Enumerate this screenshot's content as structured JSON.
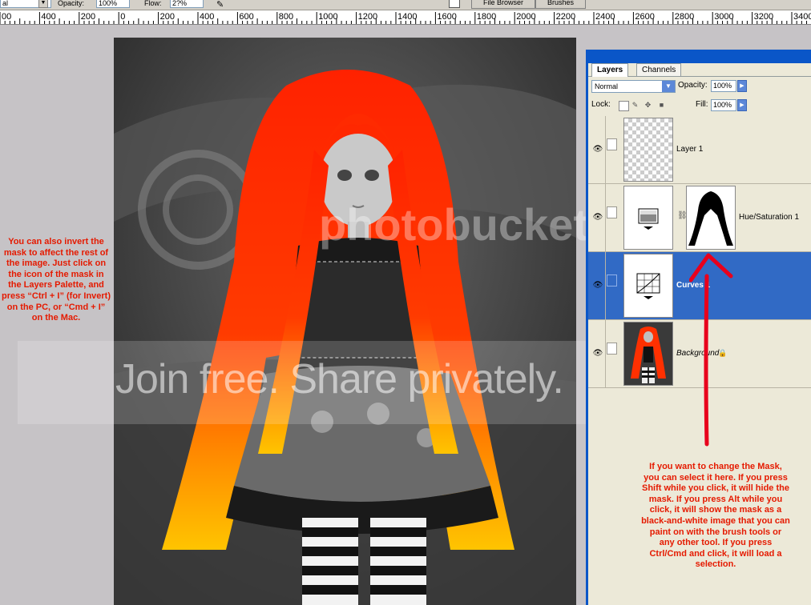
{
  "options_bar": {
    "mode_value": "al",
    "opacity_label": "Opacity:",
    "opacity_value": "100%",
    "flow_label": "Flow:",
    "flow_value": "2?%",
    "file_browser_tab": "File Browser",
    "brushes_tab": "Brushes"
  },
  "ruler": {
    "labels": [
      "00",
      "400",
      "200",
      "0",
      "200",
      "400",
      "600",
      "800",
      "1000",
      "1200",
      "1400",
      "1600",
      "1800",
      "2000",
      "2200",
      "2400",
      "2600",
      "2800",
      "3000",
      "3200",
      "3400"
    ]
  },
  "layers_panel": {
    "tabs": [
      {
        "label": "Layers",
        "active": true
      },
      {
        "label": "Channels",
        "active": false
      }
    ],
    "blend_mode": "Normal",
    "opacity_label": "Opacity:",
    "opacity_value": "100%",
    "lock_label": "Lock:",
    "fill_label": "Fill:",
    "fill_value": "100%",
    "layers": [
      {
        "name": "Layer 1",
        "visible": true,
        "active": false
      },
      {
        "name": "Hue/Saturation 1",
        "visible": true,
        "active": false
      },
      {
        "name": "Curves 1",
        "visible": true,
        "active": true
      },
      {
        "name": "Background",
        "visible": true,
        "active": false
      }
    ]
  },
  "annotations": {
    "left": "You can also invert the mask to affect the rest of the image. Just click on the icon of the mask in the Layers Palette, and press “Ctrl + I” (for Invert) on the PC, or “Cmd + I” on the Mac.",
    "right": "If you want to change the Mask, you can select it here. If you press Shift while you click, it will hide the mask. If you press Alt while you click, it will show the mask as a black-and-white image that you can paint on with the brush tools or any other tool. If you press Ctrl/Cmd and click, it will load a selection."
  },
  "watermark": {
    "logo": "photobucket",
    "text": "Join free. Share privately."
  },
  "colors": {
    "annotation_red": "#e51a00",
    "arrow_red": "#e8001c",
    "panel_blue": "#0a56c8",
    "active_layer": "#316ac5"
  }
}
